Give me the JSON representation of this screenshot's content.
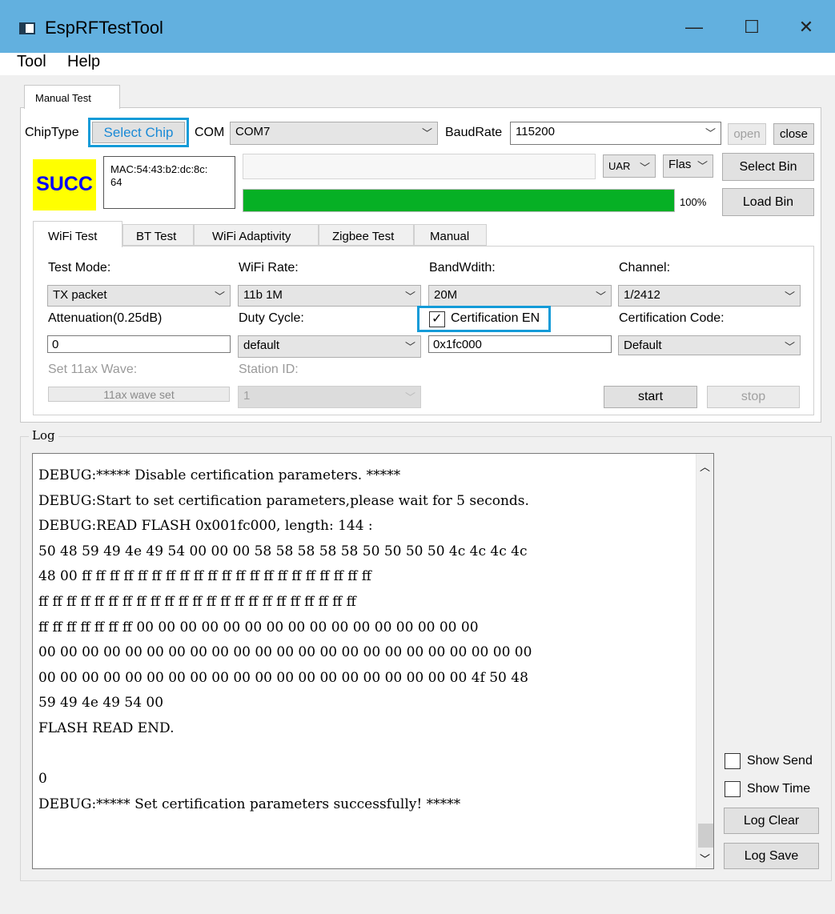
{
  "window": {
    "title": "EspRFTestTool",
    "minimize": "—",
    "maximize": "☐",
    "close": "✕"
  },
  "menu": {
    "tool": "Tool",
    "help": "Help"
  },
  "tabs": {
    "manual_test": "Manual Test"
  },
  "chip": {
    "type_label": "ChipType",
    "select_button": "Select Chip"
  },
  "com": {
    "label": "COM",
    "value": "COM7"
  },
  "baud": {
    "label": "BaudRate",
    "value": "115200"
  },
  "conn": {
    "open": "open",
    "close": "close"
  },
  "status": {
    "badge": "SUCC",
    "mac": "MAC:54:43:b2:dc:8c:\n64"
  },
  "download": {
    "uart_select": "UAR",
    "flash_select": "Flas",
    "progress_percent": 100,
    "progress_label": "100%",
    "select_bin": "Select Bin",
    "load_bin": "Load Bin"
  },
  "subtabs": [
    "WiFi Test",
    "BT Test",
    "WiFi Adaptivity",
    "Zigbee Test",
    "Manual"
  ],
  "wifi": {
    "test_mode_label": "Test Mode:",
    "test_mode_value": "TX packet",
    "rate_label": "WiFi Rate:",
    "rate_value": "11b 1M",
    "bandwidth_label": "BandWdith:",
    "bandwidth_value": "20M",
    "channel_label": "Channel:",
    "channel_value": "1/2412",
    "attenuation_label": "Attenuation(0.25dB)",
    "attenuation_value": "0",
    "duty_label": "Duty Cycle:",
    "duty_value": "default",
    "cert_en_label": "Certification EN",
    "cert_en_checked": true,
    "cert_addr_value": "0x1fc000",
    "cert_code_label": "Certification Code:",
    "cert_code_value": "Default",
    "wave_label": "Set 11ax Wave:",
    "wave_button": "11ax wave set",
    "station_label": "Station ID:",
    "station_value": "1",
    "start": "start",
    "stop": "stop"
  },
  "log": {
    "title": "Log",
    "lines": [
      "DEBUG:***** Disable certification parameters. *****",
      "DEBUG:Start to set certification parameters,please wait for 5 seconds.",
      "DEBUG:READ FLASH 0x001fc000, length: 144 :",
      "50 48 59 49 4e 49 54 00 00 00 58 58 58 58 58 50 50 50 50 4c 4c 4c 4c",
      "48 00 ff ff ff ff ff ff ff ff ff ff ff ff ff ff ff ff ff ff ff ff ff",
      "ff ff ff ff ff ff ff ff ff ff ff ff ff ff ff ff ff ff ff ff ff ff ff",
      "ff ff ff ff ff ff ff 00 00 00 00 00 00 00 00 00 00 00 00 00 00 00 00",
      "00 00 00 00 00 00 00 00 00 00 00 00 00 00 00 00 00 00 00 00 00 00 00",
      "00 00 00 00 00 00 00 00 00 00 00 00 00 00 00 00 00 00 00 00 4f 50 48",
      "59 49 4e 49 54 00",
      "FLASH READ END.",
      "",
      "0",
      "DEBUG:***** Set certification parameters successfully! *****"
    ],
    "show_send": "Show Send",
    "show_time": "Show Time",
    "clear": "Log Clear",
    "save": "Log Save"
  }
}
